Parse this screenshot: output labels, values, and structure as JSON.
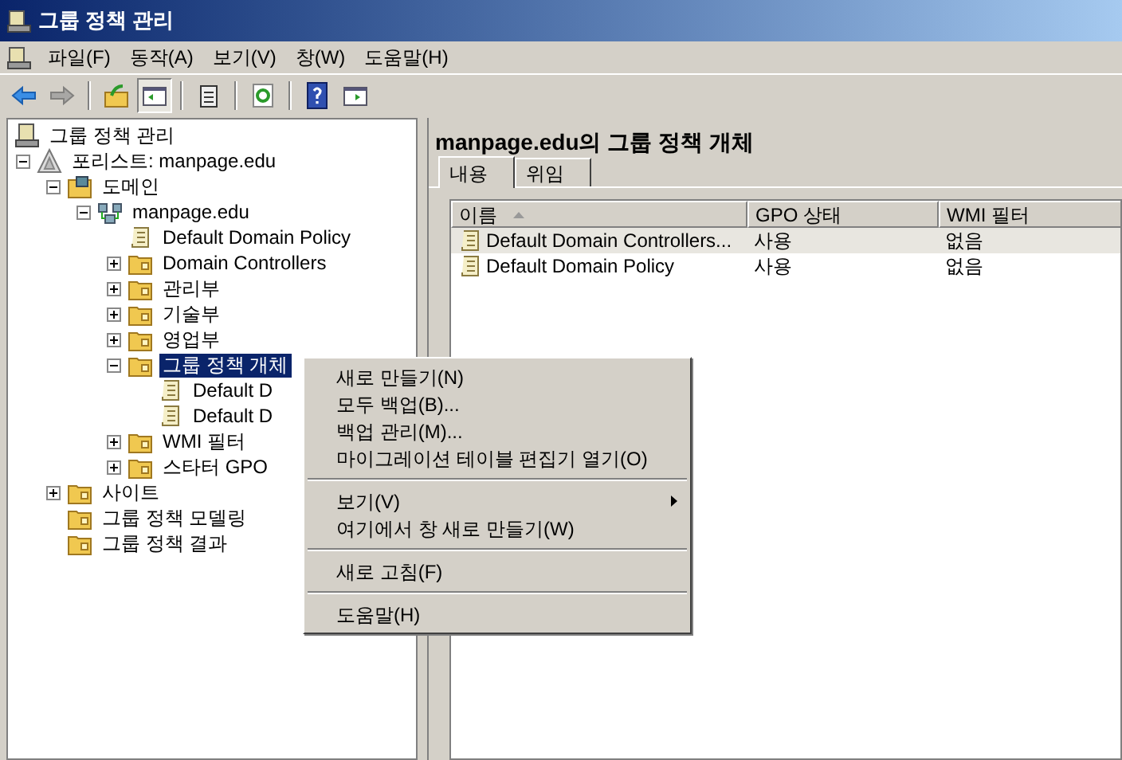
{
  "window": {
    "title": "그룹 정책 관리"
  },
  "menu_bar": [
    "파일(F)",
    "동작(A)",
    "보기(V)",
    "창(W)",
    "도움말(H)"
  ],
  "toolbar": [
    {
      "kind": "back",
      "disabled": false,
      "pressed": false
    },
    {
      "kind": "forward",
      "disabled": true,
      "pressed": false
    },
    {
      "kind": "separator"
    },
    {
      "kind": "up",
      "disabled": false,
      "pressed": false
    },
    {
      "kind": "tree",
      "disabled": false,
      "pressed": true
    },
    {
      "kind": "separator"
    },
    {
      "kind": "clipboard",
      "disabled": false,
      "pressed": false
    },
    {
      "kind": "separator"
    },
    {
      "kind": "refresh",
      "disabled": false,
      "pressed": false
    },
    {
      "kind": "separator"
    },
    {
      "kind": "help",
      "disabled": false,
      "pressed": false
    },
    {
      "kind": "pane",
      "disabled": false,
      "pressed": false
    }
  ],
  "tree": [
    {
      "label": "그룹 정책 관리",
      "kind": "console",
      "selected": false,
      "children": [
        {
          "label": "포리스트: manpage.edu",
          "kind": "forest",
          "selected": false,
          "expanded": true,
          "children": [
            {
              "label": "도메인",
              "kind": "domains",
              "selected": false,
              "expanded": true,
              "children": [
                {
                  "label": "manpage.edu",
                  "kind": "domain",
                  "selected": false,
                  "expanded": true,
                  "children": [
                    {
                      "label": "Default Domain Policy",
                      "kind": "gpo",
                      "selected": false
                    },
                    {
                      "label": "Domain Controllers",
                      "kind": "folder",
                      "selected": false,
                      "expanded": false
                    },
                    {
                      "label": "관리부",
                      "kind": "folder",
                      "selected": false,
                      "expanded": false
                    },
                    {
                      "label": "기술부",
                      "kind": "folder",
                      "selected": false,
                      "expanded": false
                    },
                    {
                      "label": "영업부",
                      "kind": "folder",
                      "selected": false,
                      "expanded": false
                    },
                    {
                      "label": "그룹 정책 개체",
                      "kind": "folder",
                      "selected": true,
                      "expanded": true,
                      "children": [
                        {
                          "label": "Default D",
                          "kind": "gpo",
                          "selected": false
                        },
                        {
                          "label": "Default D",
                          "kind": "gpo",
                          "selected": false
                        }
                      ]
                    },
                    {
                      "label": "WMI 필터",
                      "kind": "folder",
                      "selected": false,
                      "expanded": false
                    },
                    {
                      "label": "스타터 GPO",
                      "kind": "folder",
                      "selected": false,
                      "expanded": false
                    }
                  ]
                }
              ]
            },
            {
              "label": "사이트",
              "kind": "folder",
              "selected": false,
              "expanded": false
            },
            {
              "label": "그룹 정책 모델링",
              "kind": "folder",
              "selected": false
            },
            {
              "label": "그룹 정책 결과",
              "kind": "folder",
              "selected": false
            }
          ]
        }
      ]
    }
  ],
  "content": {
    "title": "manpage.edu의 그룹 정책 개체",
    "tabs": [
      {
        "label": "내용",
        "selected": true
      },
      {
        "label": "위임",
        "selected": false
      }
    ],
    "table": {
      "columns": [
        {
          "label": "이름",
          "sorted": true
        },
        {
          "label": "GPO 상태",
          "sorted": false
        },
        {
          "label": "WMI 필터",
          "sorted": false
        }
      ],
      "rows": [
        {
          "cells": [
            "Default Domain Controllers...",
            "사용",
            "없음"
          ],
          "selected": true
        },
        {
          "cells": [
            "Default Domain Policy",
            "사용",
            "없음"
          ],
          "selected": false
        }
      ]
    }
  },
  "context_menu": [
    {
      "kind": "item",
      "label": "새로 만들기(N)",
      "submenu": false
    },
    {
      "kind": "item",
      "label": "모두 백업(B)...",
      "submenu": false
    },
    {
      "kind": "item",
      "label": "백업 관리(M)...",
      "submenu": false
    },
    {
      "kind": "item",
      "label": "마이그레이션 테이블 편집기 열기(O)",
      "submenu": false
    },
    {
      "kind": "separator"
    },
    {
      "kind": "item",
      "label": "보기(V)",
      "submenu": true
    },
    {
      "kind": "item",
      "label": "여기에서 창 새로 만들기(W)",
      "submenu": false
    },
    {
      "kind": "separator"
    },
    {
      "kind": "item",
      "label": "새로 고침(F)",
      "submenu": false
    },
    {
      "kind": "separator"
    },
    {
      "kind": "item",
      "label": "도움말(H)",
      "submenu": false
    }
  ]
}
